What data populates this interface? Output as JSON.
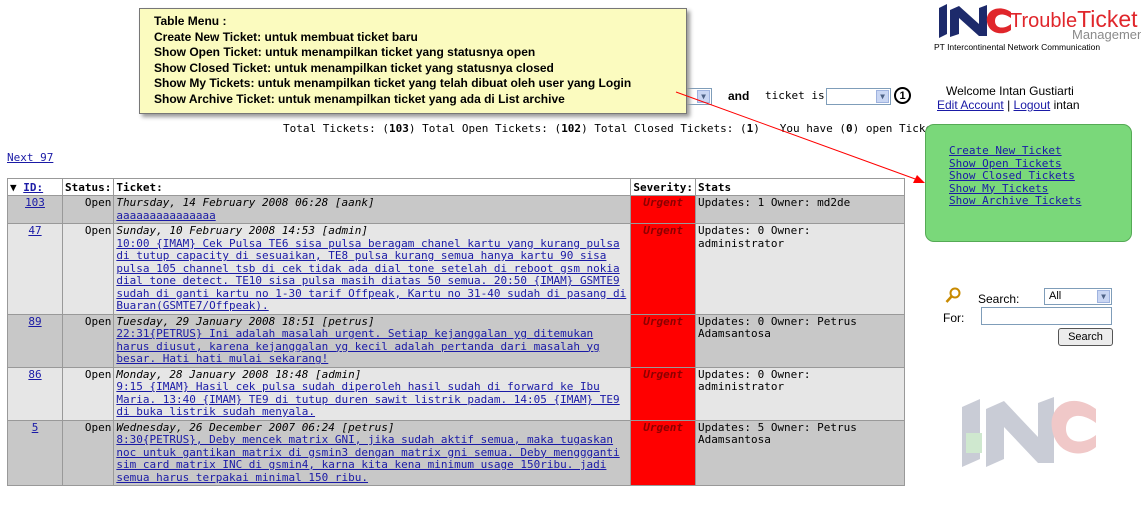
{
  "tooltip": {
    "title": "Table Menu :",
    "lines": [
      "Create New Ticket: untuk membuat ticket baru",
      "Show Open Ticket: untuk menampilkan ticket yang statusnya open",
      "Show Closed Ticket: untuk menampilkan ticket yang statusnya closed",
      "Show My Tickets: untuk menampilkan ticket yang telah dibuat oleh user yang Login",
      "Show Archive Ticket: untuk menampilkan ticket yang ada di List archive"
    ]
  },
  "filter": {
    "and_label": "and",
    "ticket_is_label": "ticket is:",
    "ticket_is_value": "",
    "annotation_number": "1"
  },
  "summary": {
    "total_label": "Total Tickets:",
    "total": "103",
    "open_label": "Total Open Tickets:",
    "open": "102",
    "closed_label": "Total Closed Tickets:",
    "closed": "1",
    "you_have_label": "You have",
    "you_have": "0",
    "open_tickets_label": "open Tickets."
  },
  "next_link": "Next 97",
  "table": {
    "headers": {
      "id": "ID:",
      "status": "Status:",
      "ticket": "Ticket:",
      "severity": "Severity:",
      "stats": "Stats"
    },
    "rows": [
      {
        "id": "103",
        "status": "Open",
        "header": "Thursday, 14 February 2008 06:28 [aank]",
        "body": "aaaaaaaaaaaaaaa",
        "severity": "Urgent",
        "stats": "Updates: 1  Owner: md2de"
      },
      {
        "id": "47",
        "status": "Open",
        "header": "Sunday, 10 February 2008 14:53 [admin]",
        "body": "10:00 {IMAM} Cek Pulsa TE6 sisa pulsa beragam chanel kartu yang kurang pulsa di tutup capacity di sesuaikan, TE8 pulsa kurang semua hanya kartu 90 sisa pulsa 105 channel tsb di cek tidak ada dial tone setelah di reboot gsm nokia dial tone detect. TE10 sisa pulsa masih diatas 50 semua. 20:50 {IMAM} GSMTE9 sudah di ganti kartu no 1-30 tarif Offpeak, Kartu no 31-40 sudah di pasang di Buaran(GSMTE7/Offpeak).",
        "severity": "Urgent",
        "stats": "Updates: 0  Owner: administrator"
      },
      {
        "id": "89",
        "status": "Open",
        "header": "Tuesday, 29 January 2008 18:51 [petrus]",
        "body": "22:31{PETRUS} Ini adalah masalah urgent. Setiap kejanggalan yg ditemukan harus diusut, karena kejanggalan yg kecil adalah pertanda dari masalah yg besar. Hati hati mulai sekarang!",
        "severity": "Urgent",
        "stats": "Updates: 0  Owner: Petrus Adamsantosa"
      },
      {
        "id": "86",
        "status": "Open",
        "header": "Monday, 28 January 2008 18:48 [admin]",
        "body": "9:15 {IMAM} Hasil cek pulsa sudah diperoleh hasil sudah di forward ke Ibu Maria. 13:40 {IMAM} TE9 di tutup duren sawit listrik padam. 14:05 {IMAM} TE9 di buka listrik sudah menyala.",
        "severity": "Urgent",
        "stats": "Updates: 0  Owner: administrator"
      },
      {
        "id": "5",
        "status": "Open",
        "header": "Wednesday, 26 December 2007 06:24 [petrus]",
        "body": "8:30{PETRUS}, Deby mencek matrix GNI, jika sudah aktif semua, maka tugaskan noc untuk gantikan matrix di gsmin3 dengan matrix gni semua. Deby menggganti sim card matrix INC di gsmin4, karna kita kena minimum usage 150ribu. jadi semua harus terpakai minimal 150 ribu.",
        "severity": "Urgent",
        "stats": "Updates: 5  Owner: Petrus Adamsantosa"
      }
    ]
  },
  "logo": {
    "brand1": "Trouble",
    "brand2": "Ticket",
    "sub": "Management",
    "company": "PT Intercontinental Network Communication"
  },
  "user": {
    "welcome": "Welcome Intan Gustiarti",
    "edit_account": "Edit Account",
    "sep": "|",
    "logout": "Logout",
    "username": "intan"
  },
  "menu": [
    "Create New Ticket",
    "Show Open Tickets",
    "Show Closed Tickets",
    "Show My Tickets",
    "Show Archive Tickets"
  ],
  "search": {
    "label": "Search:",
    "select_value": "All",
    "for_label": "For:",
    "input_value": "",
    "button": "Search"
  },
  "colors": {
    "link": "#1a1aa6",
    "urgent": "#ff0000",
    "menu_bg": "#7ad87a",
    "tooltip_bg": "#fbfbbf",
    "brand_red": "#e0262b",
    "brand_navy": "#1d2a6b"
  }
}
